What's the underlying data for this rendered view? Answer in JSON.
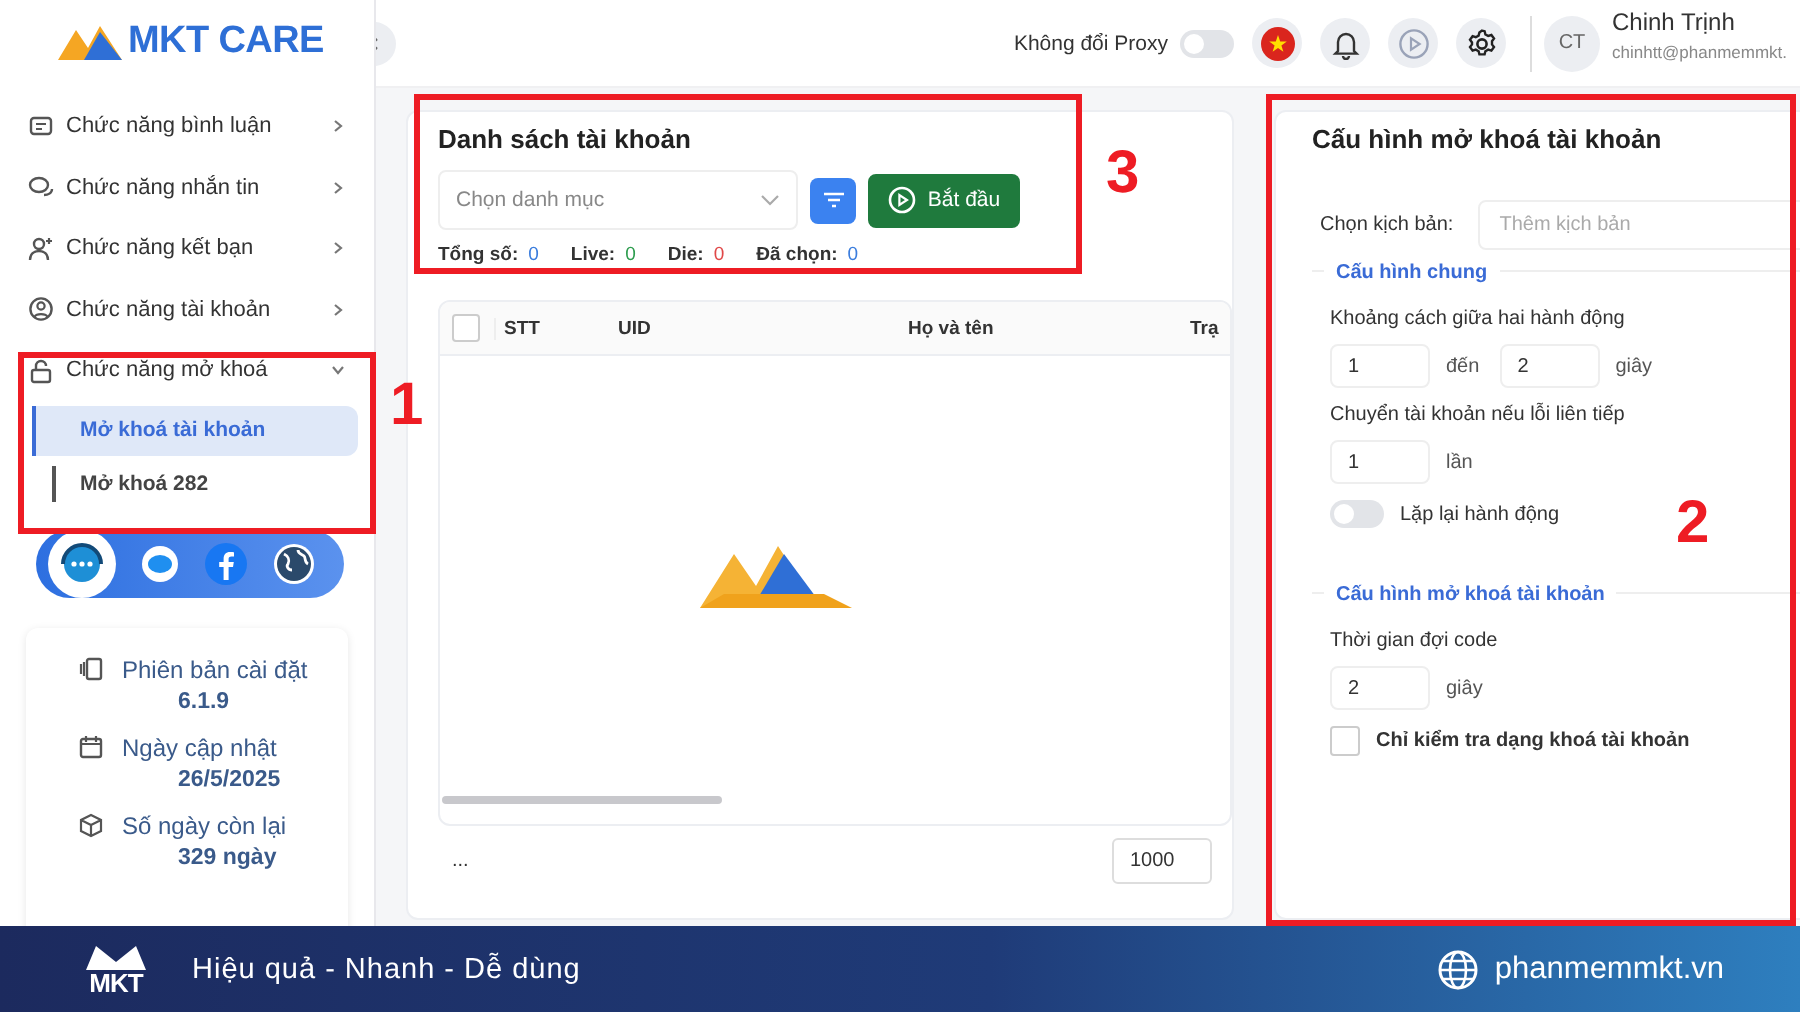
{
  "sidebar": {
    "logo_text": "MKT CARE",
    "menu": [
      {
        "kind": "comment",
        "label": "Chức năng bình luận",
        "expanded": false
      },
      {
        "kind": "chat",
        "label": "Chức năng nhắn tin",
        "expanded": false
      },
      {
        "kind": "friend",
        "label": "Chức năng kết bạn",
        "expanded": false
      },
      {
        "kind": "account",
        "label": "Chức năng tài khoản",
        "expanded": false
      },
      {
        "kind": "unlock",
        "label": "Chức năng mở khoá",
        "expanded": true,
        "children": [
          {
            "label": "Mở khoá tài khoản",
            "selected": true
          },
          {
            "label": "Mở khoá 282",
            "selected": false
          }
        ]
      }
    ],
    "info": [
      {
        "kind": "version",
        "label": "Phiên bản cài đặt",
        "value": "6.1.9"
      },
      {
        "kind": "date",
        "label": "Ngày cập nhật",
        "value": "26/5/2025"
      },
      {
        "kind": "days",
        "label": "Số ngày còn lại",
        "value": "329 ngày"
      }
    ]
  },
  "header": {
    "proxy_label": "Không đổi Proxy",
    "proxy_on": false,
    "avatar": "CT",
    "user_name": "Chinh Trịnh",
    "user_email": "chinhtt@phanmemmkt."
  },
  "account_list": {
    "title": "Danh sách tài khoản",
    "category_placeholder": "Chọn danh mục",
    "start_button": "Bắt đầu",
    "stats": [
      {
        "label": "Tổng số:",
        "value": "0",
        "color": "#3b7ddd"
      },
      {
        "label": "Live:",
        "value": "0",
        "color": "#2e9d4f"
      },
      {
        "label": "Die:",
        "value": "0",
        "color": "#e04848"
      },
      {
        "label": "Đã chọn:",
        "value": "0",
        "color": "#3b7ddd"
      }
    ],
    "table": {
      "columns": [
        "STT",
        "UID",
        "Họ và tên",
        "Trạ"
      ],
      "select_all": false
    },
    "footer_text": "...",
    "page_size": "1000"
  },
  "config": {
    "title": "Cấu hình mở khoá tài khoản",
    "script_label": "Chọn kịch bản:",
    "script_placeholder": "Thêm kịch bản",
    "sections": [
      {
        "title": "Cấu hình chung",
        "rows": [
          {
            "kind": "label",
            "text": "Khoảng cách giữa hai hành động"
          },
          {
            "kind": "range",
            "from": "1",
            "joiner": "đến",
            "to": "2",
            "unit": "giây"
          },
          {
            "kind": "label",
            "text": "Chuyển tài khoản nếu lỗi liên tiếp"
          },
          {
            "kind": "number",
            "value": "1",
            "unit": "lần"
          },
          {
            "kind": "toggle",
            "text": "Lặp lại hành động",
            "on": false
          }
        ]
      },
      {
        "title": "Cấu hình mở khoá tài khoản",
        "rows": [
          {
            "kind": "label",
            "text": "Thời gian đợi code"
          },
          {
            "kind": "number",
            "value": "2",
            "unit": "giây"
          },
          {
            "kind": "checkbox",
            "text": "Chỉ kiểm tra dạng khoá tài khoản",
            "checked": false
          }
        ]
      }
    ]
  },
  "annotations": [
    {
      "number": "1"
    },
    {
      "number": "2"
    },
    {
      "number": "3"
    }
  ],
  "banner": {
    "logo_text": "MKT",
    "slogan": "Hiệu quả - Nhanh - Dễ dùng",
    "website": "phanmemmkt.vn"
  }
}
